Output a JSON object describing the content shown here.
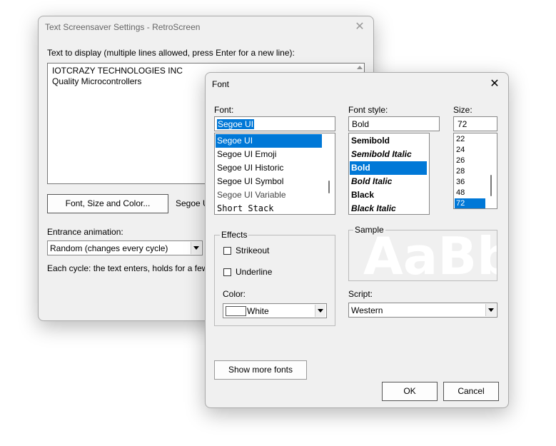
{
  "back_window": {
    "title": "Text Screensaver Settings - RetroScreen",
    "close_glyph": "✕",
    "text_label": "Text to display (multiple lines allowed, press Enter for a new line):",
    "text_lines": [
      "IOTCRAZY TECHNOLOGIES INC",
      "Quality Microcontrollers"
    ],
    "font_button": "Font, Size and Color...",
    "font_summary": "Segoe U",
    "entrance_label": "Entrance animation:",
    "entrance_value": "Random (changes every cycle)",
    "cycle_text": "Each cycle: the text enters, holds for a few"
  },
  "font_dialog": {
    "title": "Font",
    "close_glyph": "✕",
    "font_label": "Font:",
    "font_value": "Segoe UI",
    "font_list": [
      "Segoe UI",
      "Segoe UI Emoji",
      "Segoe UI Historic",
      "Segoe UI Symbol",
      "Segoe UI Variable",
      "Short Stack"
    ],
    "style_label": "Font style:",
    "style_value": "Bold",
    "style_list": [
      "Semibold",
      "Semibold Italic",
      "Bold",
      "Bold Italic",
      "Black",
      "Black Italic"
    ],
    "size_label": "Size:",
    "size_value": "72",
    "size_list": [
      "22",
      "24",
      "26",
      "28",
      "36",
      "48",
      "72"
    ],
    "effects_label": "Effects",
    "strikeout_label": "Strikeout",
    "underline_label": "Underline",
    "color_label": "Color:",
    "color_value": "White",
    "sample_label": "Sample",
    "sample_text": "AaBb",
    "script_label": "Script:",
    "script_value": "Western",
    "more_fonts_button": "Show more fonts",
    "ok_button": "OK",
    "cancel_button": "Cancel"
  },
  "colors": {
    "selection": "#0078d7",
    "dialog_bg": "#f0f0f0",
    "sample_text": "#ffffff"
  }
}
